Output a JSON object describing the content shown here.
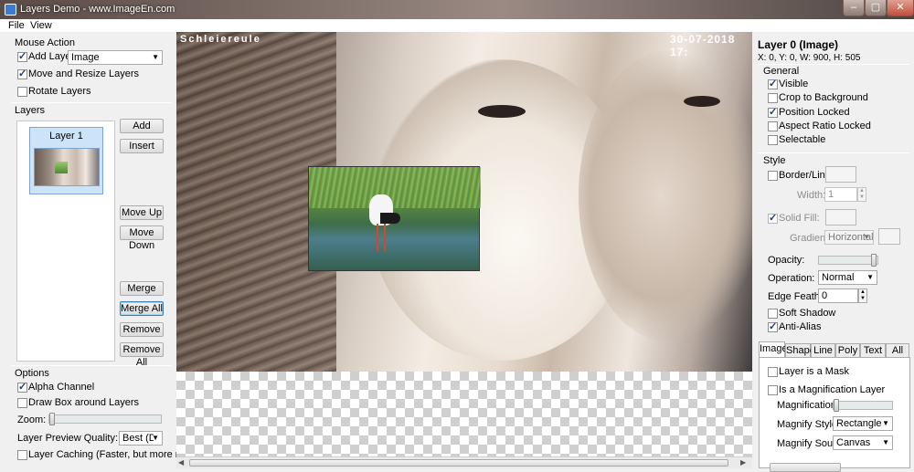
{
  "window": {
    "title": "Layers Demo - www.ImageEn.com"
  },
  "menu": [
    "File",
    "View"
  ],
  "left": {
    "mouse_action": {
      "title": "Mouse Action",
      "add_layer_label": "Add Layer:",
      "add_layer_checked": true,
      "layer_type": "Image",
      "move_resize_label": "Move and Resize Layers",
      "move_resize_checked": true,
      "rotate_label": "Rotate Layers",
      "rotate_checked": false
    },
    "layers": {
      "title": "Layers",
      "items": [
        {
          "label": "Layer 1"
        }
      ],
      "buttons": {
        "add": "Add",
        "insert": "Insert",
        "move_up": "Move Up",
        "move_down": "Move Down",
        "merge": "Merge",
        "merge_all": "Merge All",
        "remove": "Remove",
        "remove_all": "Remove All"
      }
    },
    "options": {
      "title": "Options",
      "alpha_channel_label": "Alpha Channel",
      "alpha_channel_checked": true,
      "draw_box_label": "Draw Box around Layers",
      "draw_box_checked": false,
      "zoom_label": "Zoom:",
      "zoom_level": 0.0,
      "preview_quality_label": "Layer Preview Quality:",
      "preview_quality_value": "Best (Delayed)",
      "caching_label": "Layer Caching (Faster, but more memory)",
      "caching_checked": false
    }
  },
  "canvas": {
    "overlay_left": "Schleiereule",
    "overlay_right": "30-07-2018 17:"
  },
  "right": {
    "layer_title": "Layer 0 (Image)",
    "layer_info": "X: 0, Y: 0, W: 900, H: 505",
    "general": {
      "title": "General",
      "visible": {
        "label": "Visible",
        "checked": true
      },
      "crop": {
        "label": "Crop to Background",
        "checked": false
      },
      "position_locked": {
        "label": "Position Locked",
        "checked": true
      },
      "aspect_locked": {
        "label": "Aspect Ratio Locked",
        "checked": false
      },
      "selectable": {
        "label": "Selectable",
        "checked": false
      }
    },
    "style": {
      "title": "Style",
      "border_label": "Border/Line:",
      "border_checked": false,
      "width_label": "Width:",
      "width_value": "1",
      "solid_fill_label": "Solid Fill:",
      "solid_fill_checked": true,
      "gradient_label": "Gradient:",
      "gradient_value": "Horizontal",
      "opacity_label": "Opacity:",
      "opacity_level": 1.0,
      "operation_label": "Operation:",
      "operation_value": "Normal",
      "edge_feather_label": "Edge Feather:",
      "edge_feather_value": "0",
      "soft_shadow_label": "Soft Shadow",
      "soft_shadow_checked": false,
      "anti_alias_label": "Anti-Alias",
      "anti_alias_checked": true
    },
    "tabs": [
      "Image",
      "Shape",
      "Line",
      "Poly",
      "Text",
      "All"
    ],
    "active_tab": "Image",
    "image_tab": {
      "mask_label": "Layer is a Mask",
      "mask_checked": false,
      "magnification_layer_label": "Is a Magnification Layer",
      "magnification_layer_checked": false,
      "magnification_label": "Magnification:",
      "magnification_level": 0.0,
      "magnify_style_label": "Magnify Style:",
      "magnify_style_value": "Rectangle",
      "magnify_source_label": "Magnify Source:",
      "magnify_source_value": "Canvas"
    }
  },
  "colors": {
    "accent": "#3c7fb1",
    "selection": "#cde3f7",
    "checkbox_mark": "#1c3b7a"
  }
}
